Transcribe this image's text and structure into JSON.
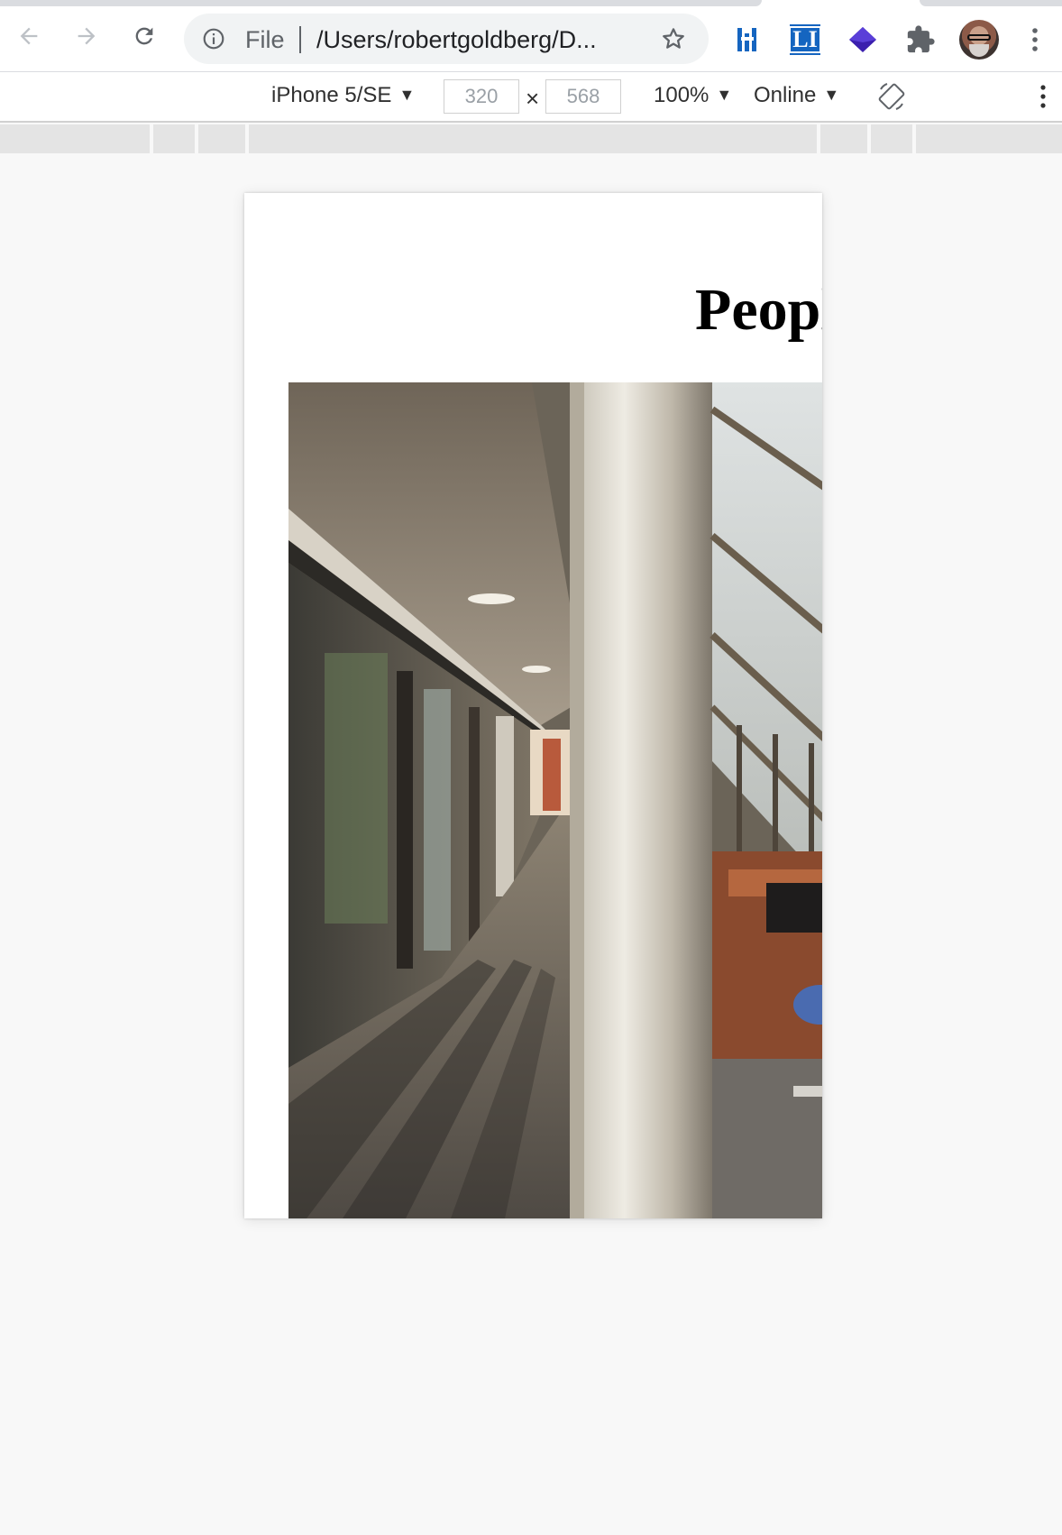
{
  "browser": {
    "omnibox": {
      "scheme": "File",
      "url": "/Users/robertgoldberg/D..."
    },
    "extensions": [
      "bars-extension-icon",
      "li-extension-icon",
      "diamond-extension-icon",
      "puzzle-extensions-icon"
    ],
    "extension_li_label": "LI"
  },
  "devtools": {
    "device": "iPhone 5/SE",
    "width": "320",
    "height": "568",
    "separator": "×",
    "zoom": "100%",
    "network": "Online"
  },
  "page": {
    "title": "People"
  },
  "colors": {
    "accent_blue": "#1565c0",
    "diamond_purple": "#3b1fae"
  }
}
